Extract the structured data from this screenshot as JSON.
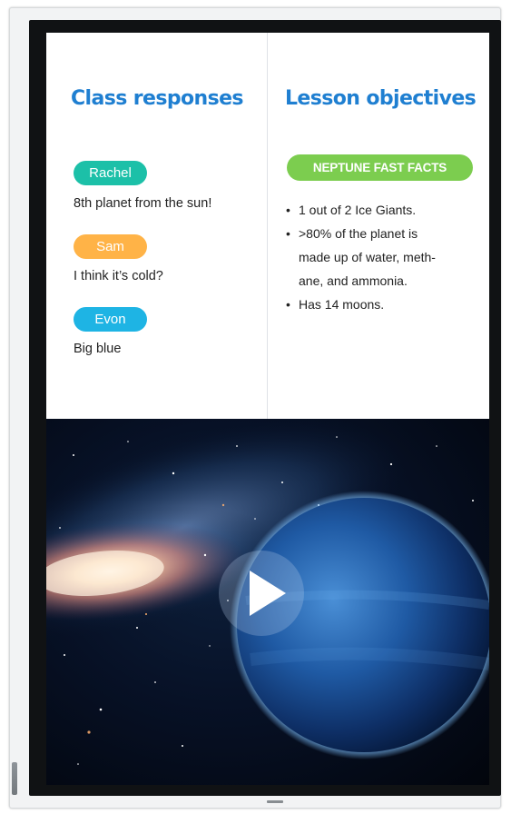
{
  "class_responses": {
    "title": "Class responses",
    "responses": [
      {
        "name": "Rachel",
        "text": "8th planet from the sun!",
        "color": "#1cc0a8"
      },
      {
        "name": "Sam",
        "text": "I think it’s cold?",
        "color": "#ffb347"
      },
      {
        "name": "Evon",
        "text": "Big blue",
        "color": "#1eb4e4"
      }
    ]
  },
  "lesson_objectives": {
    "title": "Lesson objectives",
    "badge": {
      "label": "NEPTUNE FAST FACTS",
      "color": "#7ccd4f"
    },
    "facts": [
      {
        "line1": "1 out of 2 Ice Giants.",
        "line2": "",
        "line3": ""
      },
      {
        "line1": ">80% of the planet is",
        "line2": "made up of water, meth-",
        "line3": "ane, and ammonia."
      },
      {
        "line1": "Has 14 moons.",
        "line2": "",
        "line3": ""
      }
    ],
    "bullet": "•"
  },
  "video": {
    "play_icon": "play-icon",
    "background": "galaxy-and-neptune"
  },
  "colors": {
    "title_blue": "#1f7fd1"
  }
}
